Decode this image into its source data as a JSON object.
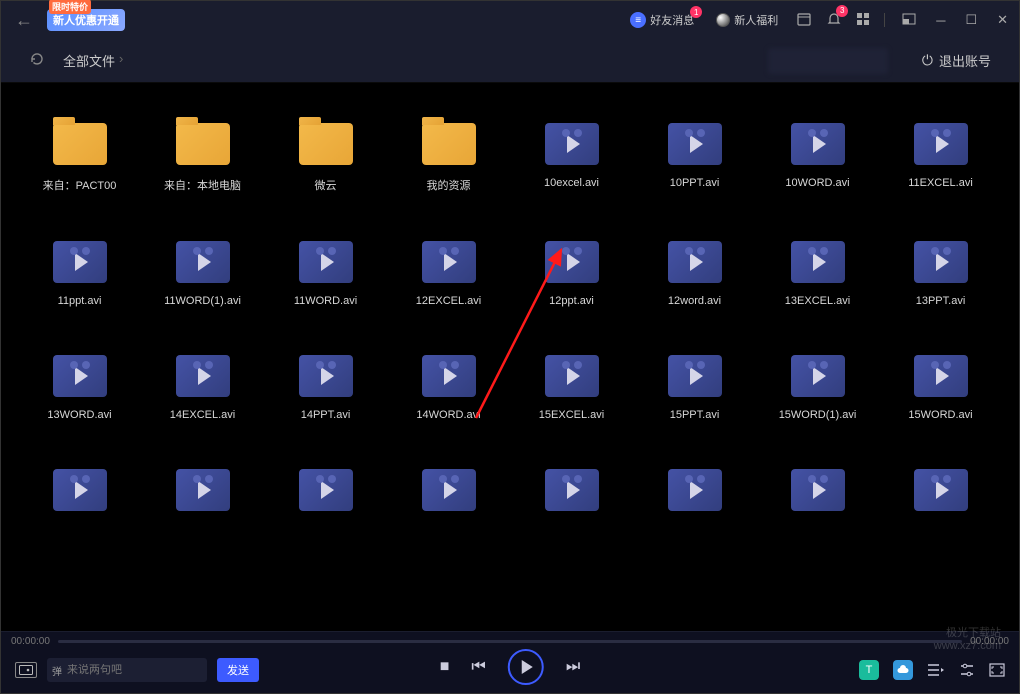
{
  "titlebar": {
    "promo_top": "限时特价",
    "promo_main": "新人优惠开通",
    "friend_msg": "好友消息",
    "friend_badge": "1",
    "newcomer": "新人福利",
    "alert_badge": "3"
  },
  "subheader": {
    "breadcrumb_root": "全部文件",
    "logout": "退出账号"
  },
  "files": [
    {
      "type": "folder",
      "label": "来自：PACT00"
    },
    {
      "type": "folder",
      "label": "来自：本地电脑"
    },
    {
      "type": "folder",
      "label": "微云"
    },
    {
      "type": "folder",
      "label": "我的资源"
    },
    {
      "type": "video",
      "label": "10excel.avi"
    },
    {
      "type": "video",
      "label": "10PPT.avi"
    },
    {
      "type": "video",
      "label": "10WORD.avi"
    },
    {
      "type": "video",
      "label": "11EXCEL.avi"
    },
    {
      "type": "video",
      "label": "11ppt.avi"
    },
    {
      "type": "video",
      "label": "11WORD(1).avi"
    },
    {
      "type": "video",
      "label": "11WORD.avi"
    },
    {
      "type": "video",
      "label": "12EXCEL.avi"
    },
    {
      "type": "video",
      "label": "12ppt.avi"
    },
    {
      "type": "video",
      "label": "12word.avi"
    },
    {
      "type": "video",
      "label": "13EXCEL.avi"
    },
    {
      "type": "video",
      "label": "13PPT.avi"
    },
    {
      "type": "video",
      "label": "13WORD.avi"
    },
    {
      "type": "video",
      "label": "14EXCEL.avi"
    },
    {
      "type": "video",
      "label": "14PPT.avi"
    },
    {
      "type": "video",
      "label": "14WORD.avi"
    },
    {
      "type": "video",
      "label": "15EXCEL.avi"
    },
    {
      "type": "video",
      "label": "15PPT.avi"
    },
    {
      "type": "video",
      "label": "15WORD(1).avi"
    },
    {
      "type": "video",
      "label": "15WORD.avi"
    },
    {
      "type": "video",
      "label": ""
    },
    {
      "type": "video",
      "label": ""
    },
    {
      "type": "video",
      "label": ""
    },
    {
      "type": "video",
      "label": ""
    },
    {
      "type": "video",
      "label": ""
    },
    {
      "type": "video",
      "label": ""
    },
    {
      "type": "video",
      "label": ""
    },
    {
      "type": "video",
      "label": ""
    }
  ],
  "player": {
    "time_current": "00:00:00",
    "time_total": "00:00:00",
    "danmu_tag": "弹",
    "danmu_placeholder": "来说两句吧",
    "send": "发送"
  },
  "watermark": {
    "line1": "极光下载站",
    "line2": "www.xz7.com"
  }
}
